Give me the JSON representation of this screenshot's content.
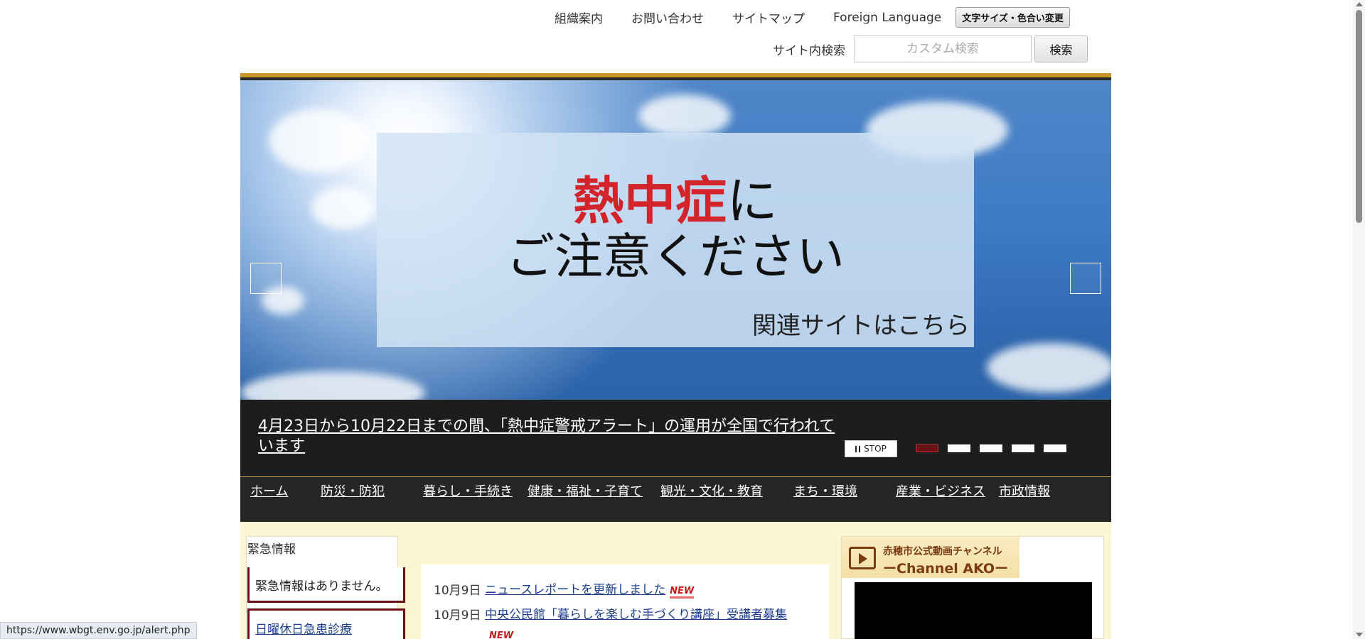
{
  "header": {
    "links": [
      "組織案内",
      "お問い合わせ",
      "サイトマップ",
      "Foreign Language"
    ],
    "font_size_button": "文字サイズ・色合い変更",
    "search_label": "サイト内検索",
    "search_placeholder": "カスタム検索",
    "search_button": "検索"
  },
  "slider": {
    "headline_red": "熱中症",
    "headline_suffix": "に",
    "headline_line2": "ご注意ください",
    "related_link": "関連サイトはこちら",
    "caption": "4月23日から10月22日までの間、「熱中症警戒アラート」の運用が全国で行われています",
    "stop_label": "STOP",
    "slide_count": 5,
    "active_slide": 1
  },
  "global_nav": [
    "ホーム",
    "防災・防犯",
    "暮らし・手続き",
    "健康・福祉・子育て",
    "観光・文化・教育",
    "まち・環境",
    "産業・ビジネス",
    "市政情報"
  ],
  "emergency": {
    "title": "緊急情報",
    "message": "緊急情報はありません。",
    "link": "日曜休日急患診療"
  },
  "news": [
    {
      "date": "10月9日",
      "title": "ニュースレポートを更新しました",
      "badge": "NEW"
    },
    {
      "date": "10月9日",
      "title": "中央公民館「暮らしを楽しむ手づくり講座」受講者募集",
      "badge": "NEW"
    }
  ],
  "video": {
    "line1": "赤穂市公式動画チャンネル",
    "line2": "ーChannel AKOー"
  },
  "status_url": "https://www.wbgt.env.go.jp/alert.php",
  "colors": {
    "accent_gold": "#c8962a",
    "nav_bg": "#262626",
    "content_bg": "#fdf6d2",
    "emergency_border": "#6d0f16",
    "headline_red": "#d3232b",
    "link_blue": "#1a3d8f"
  }
}
